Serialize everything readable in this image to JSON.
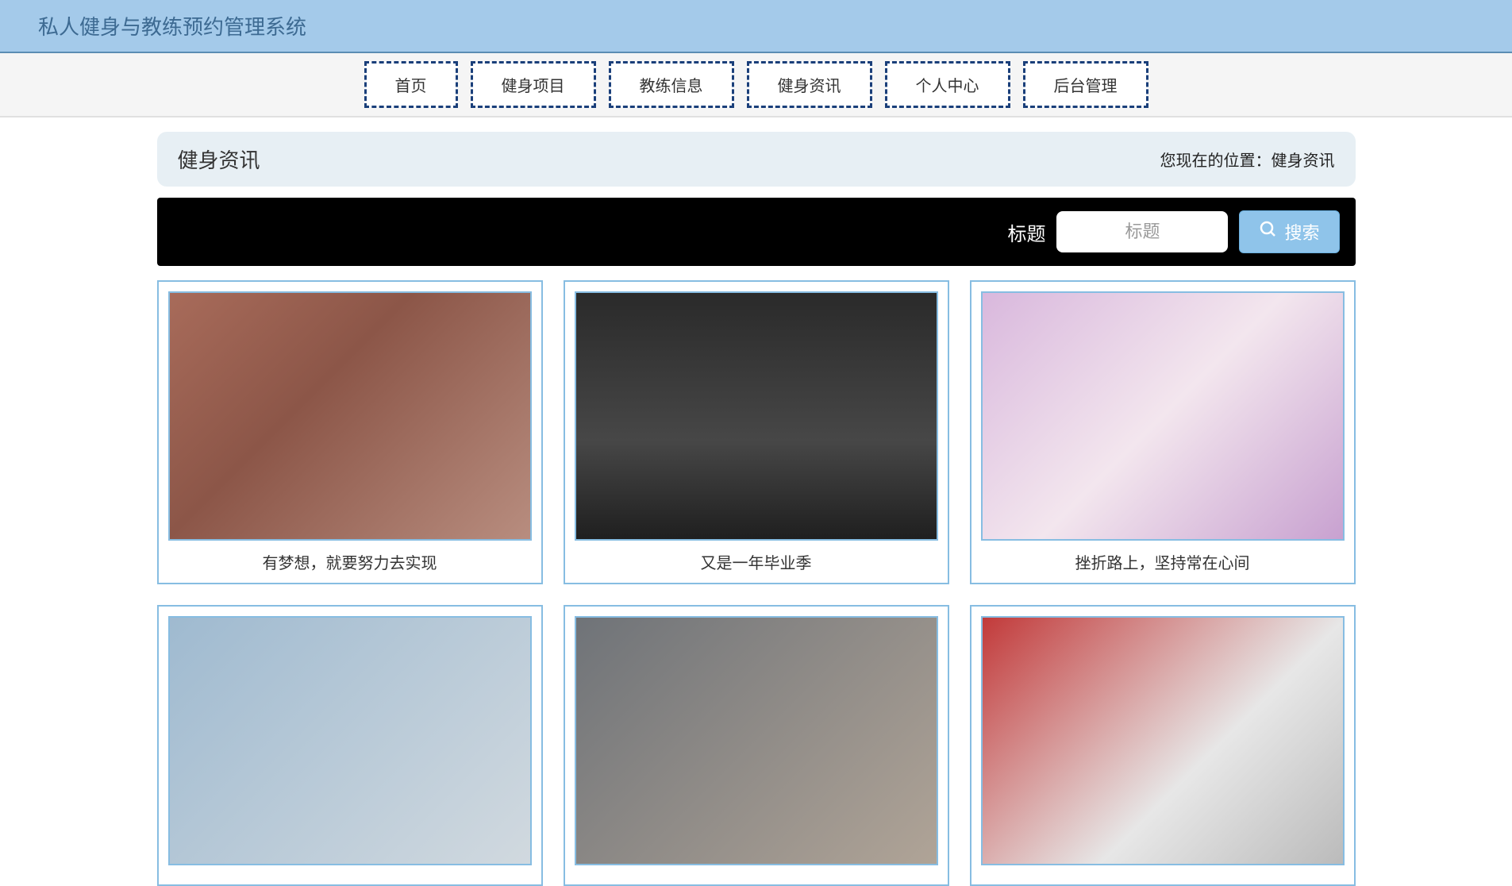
{
  "header": {
    "title": "私人健身与教练预约管理系统"
  },
  "nav": {
    "items": [
      {
        "label": "首页"
      },
      {
        "label": "健身项目"
      },
      {
        "label": "教练信息"
      },
      {
        "label": "健身资讯"
      },
      {
        "label": "个人中心"
      },
      {
        "label": "后台管理"
      }
    ]
  },
  "breadcrumb": {
    "title": "健身资讯",
    "location_prefix": "您现在的位置：",
    "location": "健身资讯"
  },
  "search": {
    "label": "标题",
    "placeholder": "标题",
    "button": "搜索"
  },
  "articles": [
    {
      "title": "有梦想，就要努力去实现",
      "img_class": "ph-brick"
    },
    {
      "title": "又是一年毕业季",
      "img_class": "ph-dark"
    },
    {
      "title": "挫折路上，坚持常在心间",
      "img_class": "ph-yoga"
    },
    {
      "title": "",
      "img_class": "ph-fit"
    },
    {
      "title": "",
      "img_class": "ph-train"
    },
    {
      "title": "",
      "img_class": "ph-gym"
    }
  ]
}
